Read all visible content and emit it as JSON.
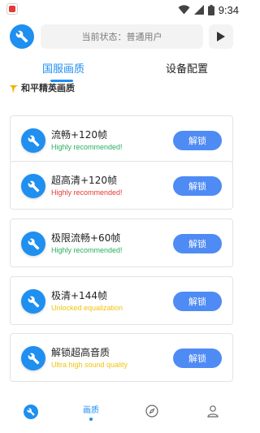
{
  "status_bar": {
    "time": "9:34",
    "icons": [
      "wifi-icon",
      "cell-signal-icon",
      "battery-icon"
    ]
  },
  "header": {
    "app_icon": "wrench-icon",
    "status_text": "当前状态：普通用户",
    "play_icon": "play-icon"
  },
  "tabs": [
    {
      "label": "国服画质",
      "active": true
    },
    {
      "label": "设备配置",
      "active": false
    }
  ],
  "section": {
    "title": "和平精英画质"
  },
  "cards": [
    {
      "title": "流畅+120帧",
      "subtitle": "Highly recommended!",
      "subtitle_color": "#27ae60",
      "button": "解锁",
      "icon": "wrench-icon"
    },
    {
      "title": "超高清+120帧",
      "subtitle": "Highly recommended!",
      "subtitle_color": "#e53935",
      "button": "解锁",
      "icon": "wrench-icon"
    },
    {
      "title": "极限流畅+60帧",
      "subtitle": "Highly recommended!",
      "subtitle_color": "#27ae60",
      "button": "解锁",
      "icon": "wrench-icon"
    },
    {
      "title": "极清+144帧",
      "subtitle": "Unlocked equalization",
      "subtitle_color": "#f1c40f",
      "button": "解锁",
      "icon": "wrench-icon"
    },
    {
      "title": "解锁超高音质",
      "subtitle": "Ultra high sound quality",
      "subtitle_color": "#f1c40f",
      "button": "解锁",
      "icon": "wrench-icon"
    }
  ],
  "bottom_nav": {
    "items": [
      {
        "icon": "wrench-icon",
        "label": ""
      },
      {
        "icon": "",
        "label": "画质"
      },
      {
        "icon": "compass-icon",
        "label": ""
      },
      {
        "icon": "user-icon",
        "label": ""
      }
    ]
  },
  "colors": {
    "accent": "#1f8ff0",
    "button": "#4f8bf4",
    "green": "#27ae60",
    "red": "#e53935",
    "yellow": "#f1c40f"
  }
}
